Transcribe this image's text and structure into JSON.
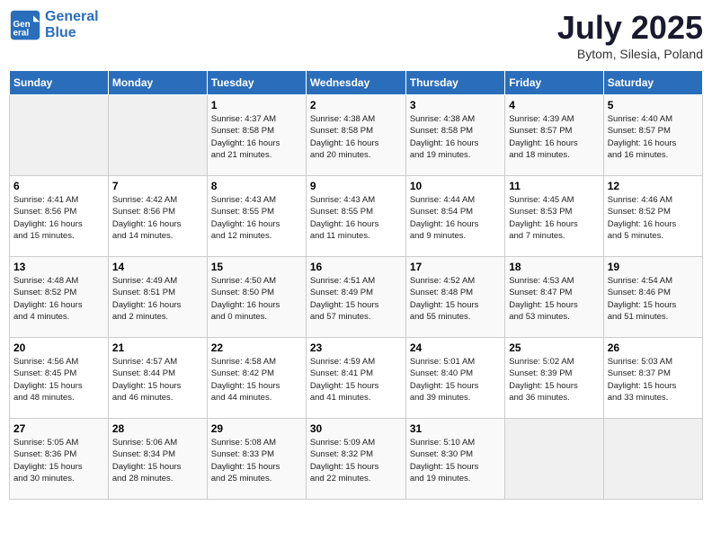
{
  "header": {
    "logo_line1": "General",
    "logo_line2": "Blue",
    "month_title": "July 2025",
    "location": "Bytom, Silesia, Poland"
  },
  "weekdays": [
    "Sunday",
    "Monday",
    "Tuesday",
    "Wednesday",
    "Thursday",
    "Friday",
    "Saturday"
  ],
  "weeks": [
    [
      {
        "day": "",
        "info": ""
      },
      {
        "day": "",
        "info": ""
      },
      {
        "day": "1",
        "info": "Sunrise: 4:37 AM\nSunset: 8:58 PM\nDaylight: 16 hours\nand 21 minutes."
      },
      {
        "day": "2",
        "info": "Sunrise: 4:38 AM\nSunset: 8:58 PM\nDaylight: 16 hours\nand 20 minutes."
      },
      {
        "day": "3",
        "info": "Sunrise: 4:38 AM\nSunset: 8:58 PM\nDaylight: 16 hours\nand 19 minutes."
      },
      {
        "day": "4",
        "info": "Sunrise: 4:39 AM\nSunset: 8:57 PM\nDaylight: 16 hours\nand 18 minutes."
      },
      {
        "day": "5",
        "info": "Sunrise: 4:40 AM\nSunset: 8:57 PM\nDaylight: 16 hours\nand 16 minutes."
      }
    ],
    [
      {
        "day": "6",
        "info": "Sunrise: 4:41 AM\nSunset: 8:56 PM\nDaylight: 16 hours\nand 15 minutes."
      },
      {
        "day": "7",
        "info": "Sunrise: 4:42 AM\nSunset: 8:56 PM\nDaylight: 16 hours\nand 14 minutes."
      },
      {
        "day": "8",
        "info": "Sunrise: 4:43 AM\nSunset: 8:55 PM\nDaylight: 16 hours\nand 12 minutes."
      },
      {
        "day": "9",
        "info": "Sunrise: 4:43 AM\nSunset: 8:55 PM\nDaylight: 16 hours\nand 11 minutes."
      },
      {
        "day": "10",
        "info": "Sunrise: 4:44 AM\nSunset: 8:54 PM\nDaylight: 16 hours\nand 9 minutes."
      },
      {
        "day": "11",
        "info": "Sunrise: 4:45 AM\nSunset: 8:53 PM\nDaylight: 16 hours\nand 7 minutes."
      },
      {
        "day": "12",
        "info": "Sunrise: 4:46 AM\nSunset: 8:52 PM\nDaylight: 16 hours\nand 5 minutes."
      }
    ],
    [
      {
        "day": "13",
        "info": "Sunrise: 4:48 AM\nSunset: 8:52 PM\nDaylight: 16 hours\nand 4 minutes."
      },
      {
        "day": "14",
        "info": "Sunrise: 4:49 AM\nSunset: 8:51 PM\nDaylight: 16 hours\nand 2 minutes."
      },
      {
        "day": "15",
        "info": "Sunrise: 4:50 AM\nSunset: 8:50 PM\nDaylight: 16 hours\nand 0 minutes."
      },
      {
        "day": "16",
        "info": "Sunrise: 4:51 AM\nSunset: 8:49 PM\nDaylight: 15 hours\nand 57 minutes."
      },
      {
        "day": "17",
        "info": "Sunrise: 4:52 AM\nSunset: 8:48 PM\nDaylight: 15 hours\nand 55 minutes."
      },
      {
        "day": "18",
        "info": "Sunrise: 4:53 AM\nSunset: 8:47 PM\nDaylight: 15 hours\nand 53 minutes."
      },
      {
        "day": "19",
        "info": "Sunrise: 4:54 AM\nSunset: 8:46 PM\nDaylight: 15 hours\nand 51 minutes."
      }
    ],
    [
      {
        "day": "20",
        "info": "Sunrise: 4:56 AM\nSunset: 8:45 PM\nDaylight: 15 hours\nand 48 minutes."
      },
      {
        "day": "21",
        "info": "Sunrise: 4:57 AM\nSunset: 8:44 PM\nDaylight: 15 hours\nand 46 minutes."
      },
      {
        "day": "22",
        "info": "Sunrise: 4:58 AM\nSunset: 8:42 PM\nDaylight: 15 hours\nand 44 minutes."
      },
      {
        "day": "23",
        "info": "Sunrise: 4:59 AM\nSunset: 8:41 PM\nDaylight: 15 hours\nand 41 minutes."
      },
      {
        "day": "24",
        "info": "Sunrise: 5:01 AM\nSunset: 8:40 PM\nDaylight: 15 hours\nand 39 minutes."
      },
      {
        "day": "25",
        "info": "Sunrise: 5:02 AM\nSunset: 8:39 PM\nDaylight: 15 hours\nand 36 minutes."
      },
      {
        "day": "26",
        "info": "Sunrise: 5:03 AM\nSunset: 8:37 PM\nDaylight: 15 hours\nand 33 minutes."
      }
    ],
    [
      {
        "day": "27",
        "info": "Sunrise: 5:05 AM\nSunset: 8:36 PM\nDaylight: 15 hours\nand 30 minutes."
      },
      {
        "day": "28",
        "info": "Sunrise: 5:06 AM\nSunset: 8:34 PM\nDaylight: 15 hours\nand 28 minutes."
      },
      {
        "day": "29",
        "info": "Sunrise: 5:08 AM\nSunset: 8:33 PM\nDaylight: 15 hours\nand 25 minutes."
      },
      {
        "day": "30",
        "info": "Sunrise: 5:09 AM\nSunset: 8:32 PM\nDaylight: 15 hours\nand 22 minutes."
      },
      {
        "day": "31",
        "info": "Sunrise: 5:10 AM\nSunset: 8:30 PM\nDaylight: 15 hours\nand 19 minutes."
      },
      {
        "day": "",
        "info": ""
      },
      {
        "day": "",
        "info": ""
      }
    ]
  ]
}
